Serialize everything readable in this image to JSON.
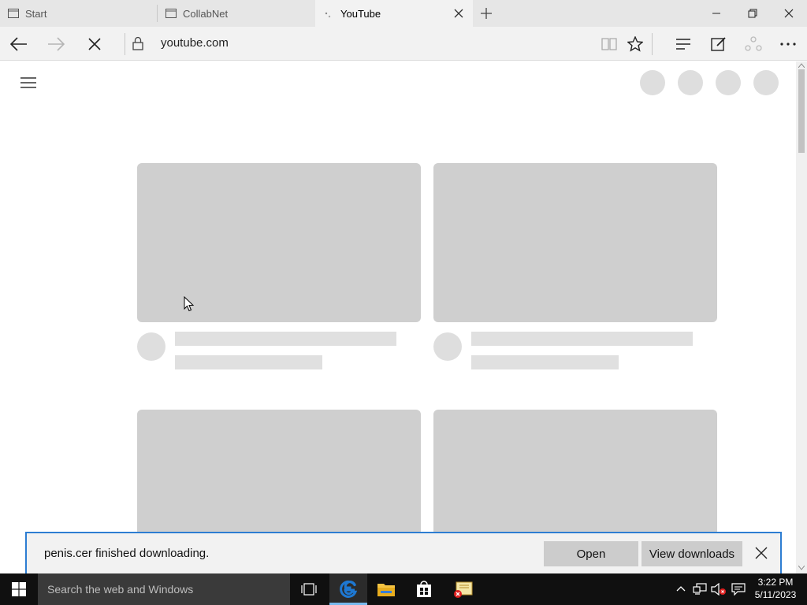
{
  "browser": {
    "tabs": [
      {
        "label": "Start",
        "active": false
      },
      {
        "label": "CollabNet",
        "active": false
      },
      {
        "label": "YouTube",
        "active": true
      }
    ],
    "address": "youtube.com"
  },
  "download_bar": {
    "message": "penis.cer finished downloading.",
    "open_label": "Open",
    "view_label": "View downloads"
  },
  "taskbar": {
    "search_placeholder": "Search the web and Windows",
    "time": "3:22 PM",
    "date": "5/11/2023"
  },
  "icons": {
    "back": "back-arrow-icon",
    "forward": "forward-arrow-icon",
    "stop": "stop-loading-icon",
    "lock": "lock-icon",
    "reading_view": "reading-view-icon",
    "favorite": "star-icon",
    "hub": "hub-icon",
    "web_note": "web-note-icon",
    "share": "share-icon",
    "more": "more-icon"
  },
  "colors": {
    "accent": "#2d7dd2",
    "edge_blue": "#1e78d2",
    "skeleton": "#cfcfcf"
  }
}
